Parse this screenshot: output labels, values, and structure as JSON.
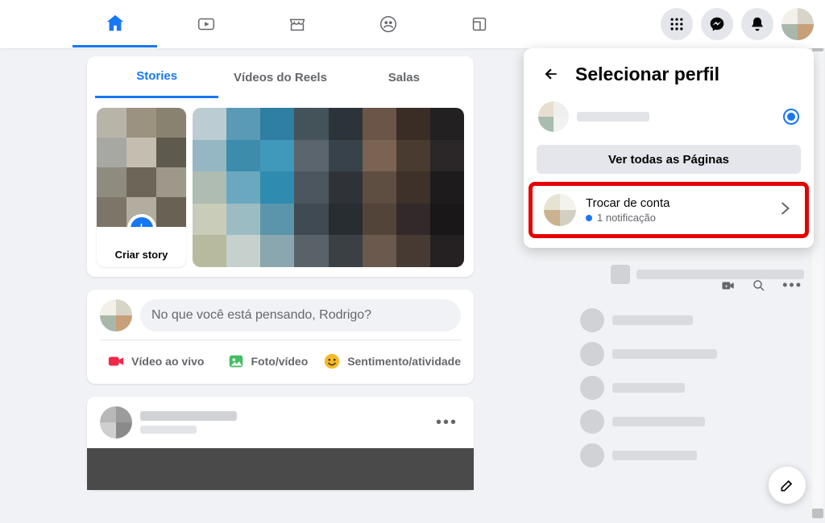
{
  "nav": {
    "active": "home"
  },
  "stories": {
    "tabs": {
      "stories": "Stories",
      "reels": "Vídeos do Reels",
      "rooms": "Salas"
    },
    "create_label": "Criar story"
  },
  "composer": {
    "placeholder": "No que você está pensando, Rodrigo?",
    "live": "Vídeo ao vivo",
    "photo": "Foto/vídeo",
    "feeling": "Sentimento/atividade"
  },
  "dropdown": {
    "title": "Selecionar perfil",
    "all_pages": "Ver todas as Páginas",
    "switch_title": "Trocar de conta",
    "switch_sub": "1 notificação"
  },
  "colors": {
    "primary": "#1877f2",
    "highlight": "#e60000"
  }
}
